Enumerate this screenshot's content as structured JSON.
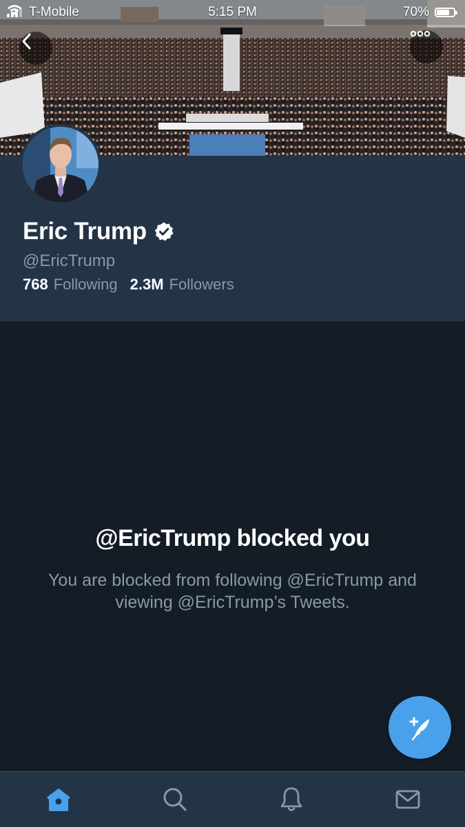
{
  "status_bar": {
    "carrier": "T-Mobile",
    "time": "5:15 PM",
    "battery": "70%",
    "battery_level": 0.7
  },
  "header": {
    "back_icon": "chevron-left-icon",
    "more_icon": "more-horizontal-icon"
  },
  "profile": {
    "display_name": "Eric Trump",
    "verified": true,
    "handle": "@EricTrump",
    "following_count": "768",
    "following_label": "Following",
    "followers_count": "2.3M",
    "followers_label": "Followers"
  },
  "blocked": {
    "title": "@EricTrump blocked you",
    "description": "You are blocked from following @EricTrump and viewing @EricTrump’s Tweets."
  },
  "compose": {
    "icon": "compose-tweet-icon"
  },
  "tab_bar": {
    "tabs": [
      {
        "name": "home",
        "icon": "home-icon",
        "active": true
      },
      {
        "name": "search",
        "icon": "search-icon",
        "active": false
      },
      {
        "name": "notifications",
        "icon": "bell-icon",
        "active": false
      },
      {
        "name": "messages",
        "icon": "mail-icon",
        "active": false
      }
    ]
  },
  "colors": {
    "background": "#141d26",
    "card": "#243447",
    "accent": "#4aa1eb",
    "secondary_text": "#8899a6"
  }
}
